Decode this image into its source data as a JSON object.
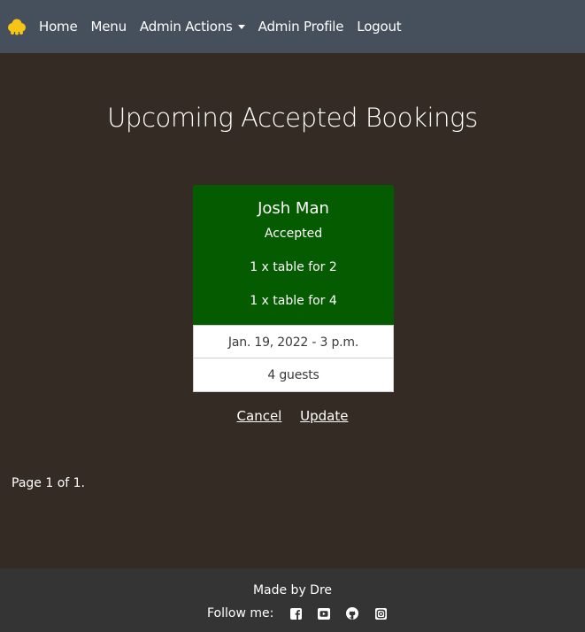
{
  "navbar": {
    "brand_icon": "yellow-cloud-logo-icon",
    "items": [
      {
        "label": "Home"
      },
      {
        "label": "Menu"
      },
      {
        "label": "Admin Actions"
      },
      {
        "label": "Admin Profile"
      },
      {
        "label": "Logout"
      }
    ]
  },
  "page": {
    "title": "Upcoming Accepted Bookings"
  },
  "booking": {
    "name": "Josh Man",
    "status": "Accepted",
    "tables": [
      "1 x table for 2",
      "1 x table for 4"
    ],
    "datetime": "Jan. 19, 2022 - 3 p.m.",
    "guests": "4 guests",
    "status_color": "#055c00",
    "actions": {
      "cancel": "Cancel",
      "update": "Update"
    }
  },
  "pagination": {
    "text": "Page 1 of 1."
  },
  "footer": {
    "made_by": "Made by Dre",
    "follow_label": "Follow me:",
    "social_icons": [
      "facebook-icon",
      "youtube-icon",
      "github-icon",
      "instagram-icon"
    ]
  },
  "colors": {
    "background": "#342c24",
    "navbar": "#46505c",
    "footer": "#343434",
    "brand": "#f4c517"
  }
}
